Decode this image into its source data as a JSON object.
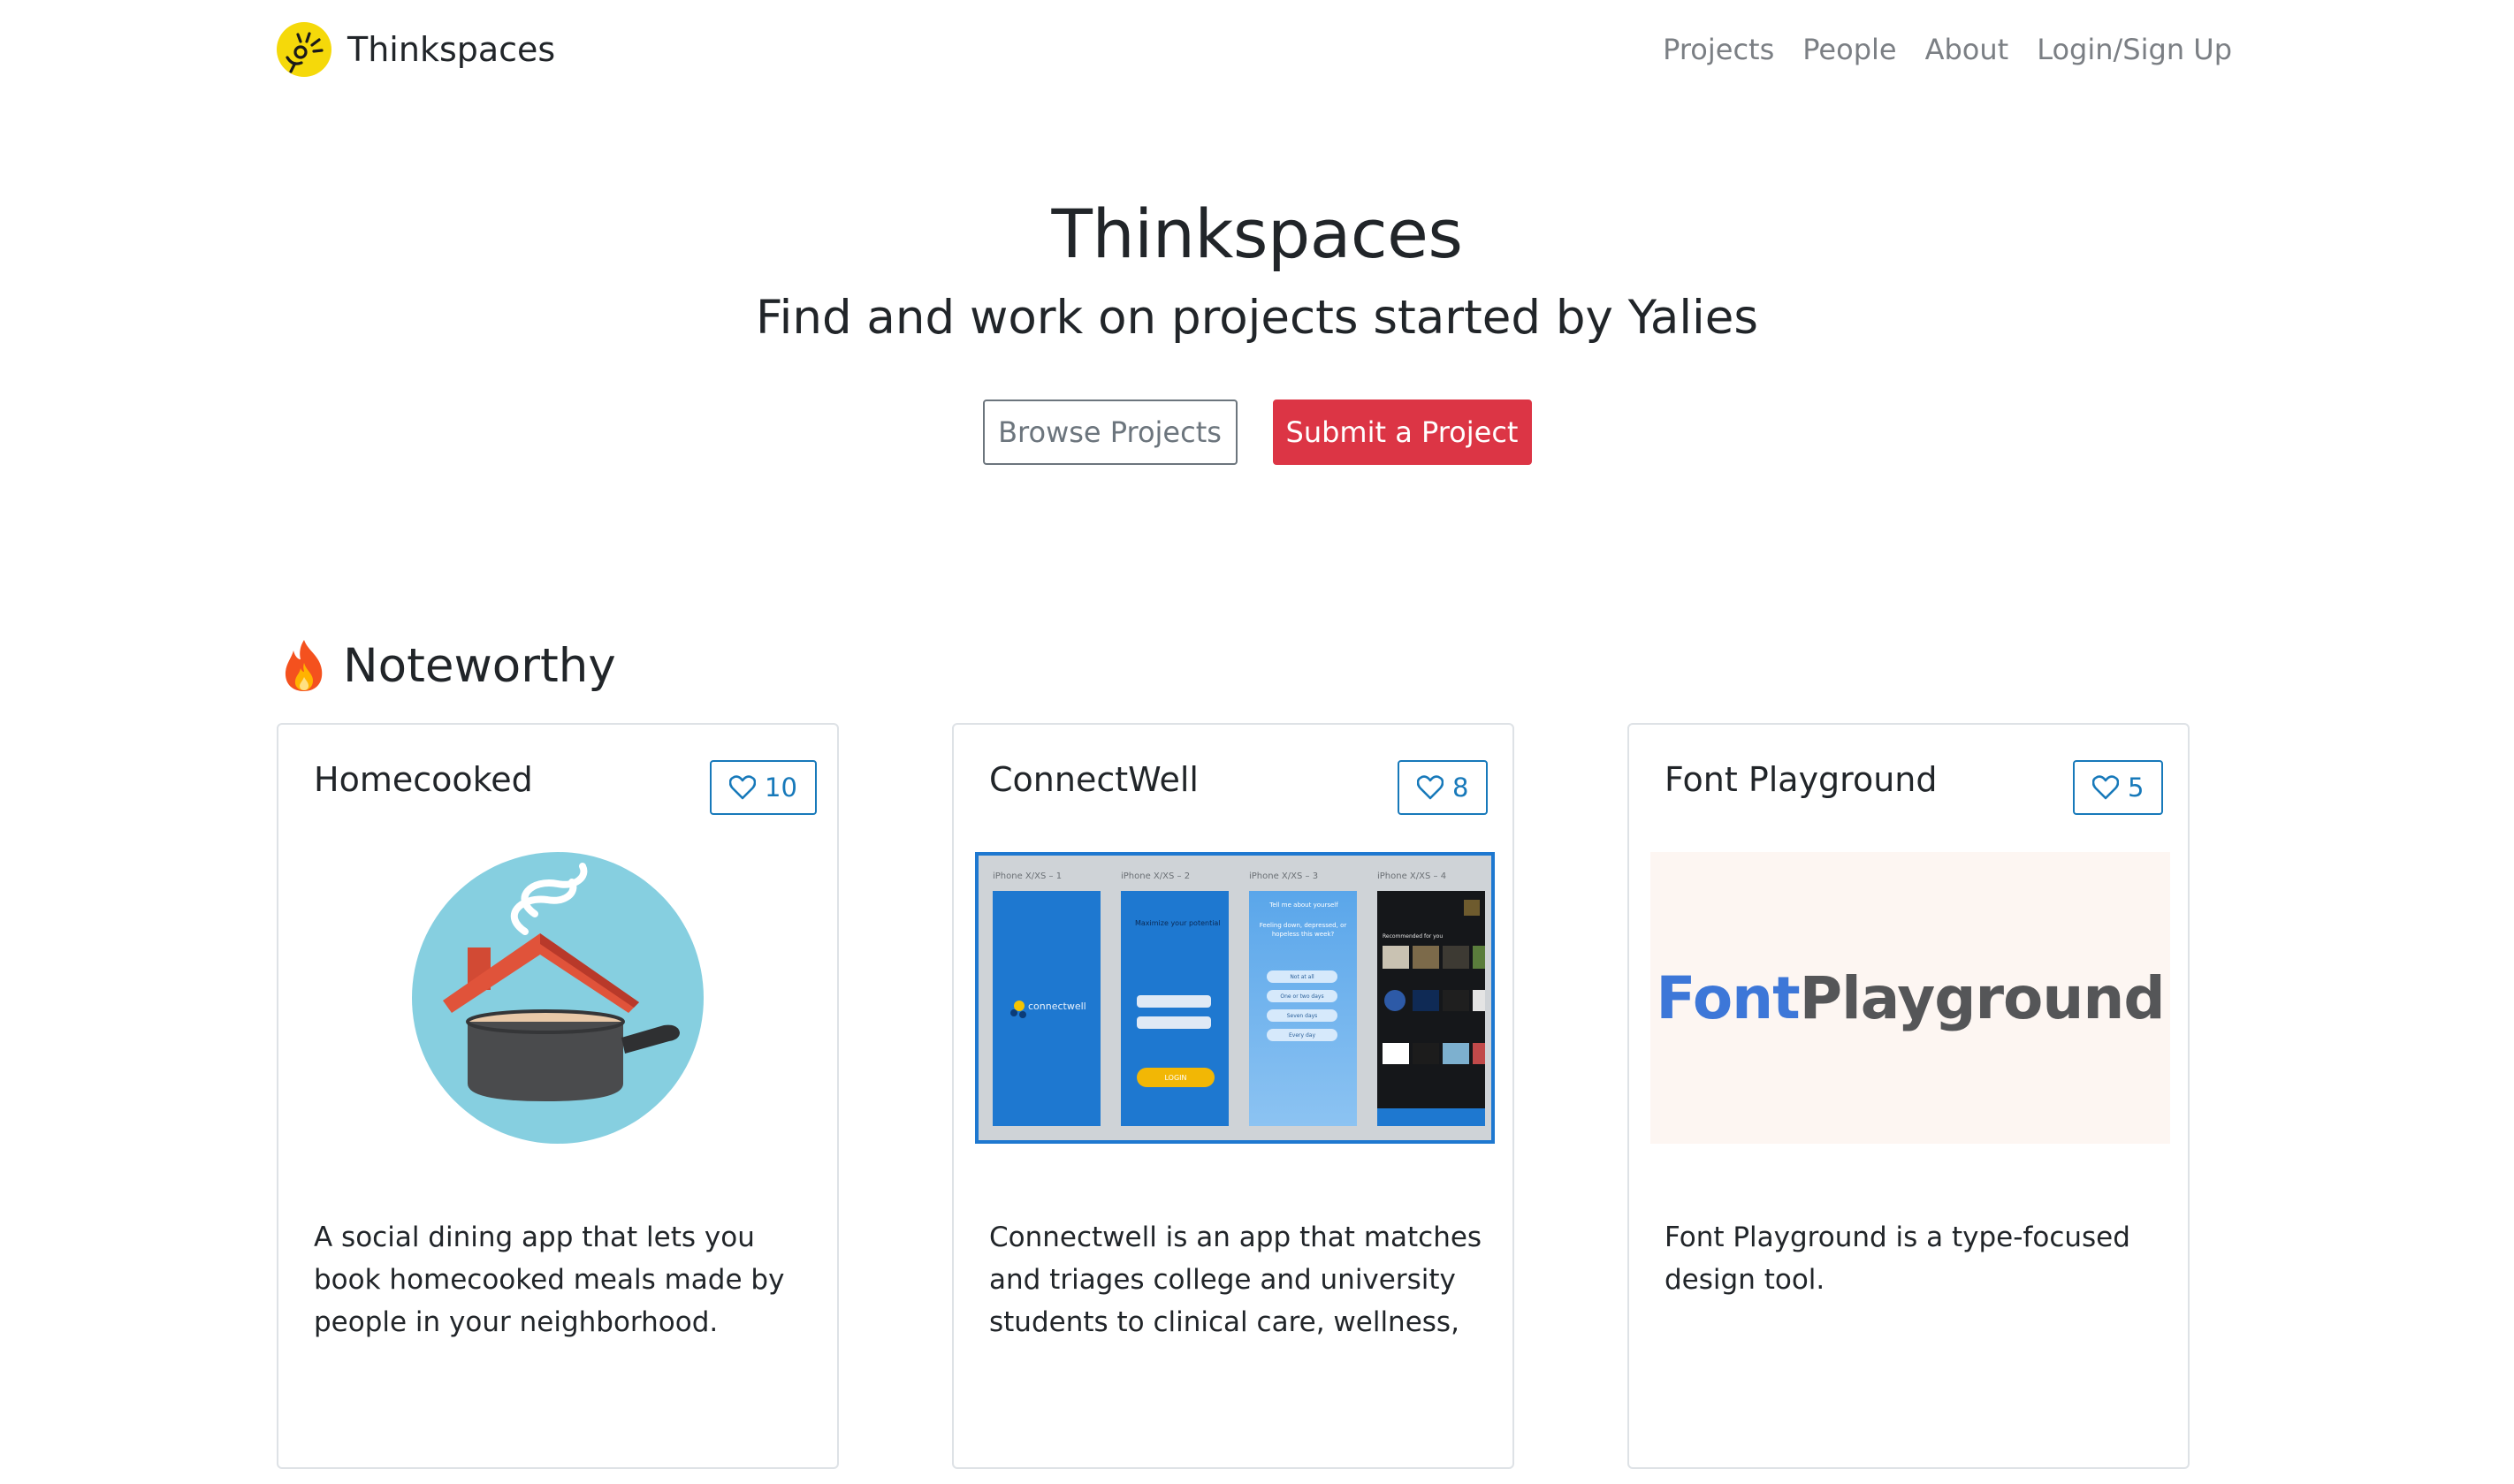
{
  "navbar": {
    "brand": "Thinkspaces",
    "links": [
      "Projects",
      "People",
      "About",
      "Login/Sign Up"
    ]
  },
  "hero": {
    "title": "Thinkspaces",
    "subtitle": "Find and work on projects started by Yalies",
    "browse_label": "Browse Projects",
    "submit_label": "Submit a Project"
  },
  "section": {
    "title": "Noteworthy",
    "icon": "fire-icon"
  },
  "cards": [
    {
      "title": "Homecooked",
      "likes": "10",
      "description": "A social dining app that lets you book homecooked meals made by people in your neighborhood."
    },
    {
      "title": "ConnectWell",
      "likes": "8",
      "description": "Connectwell is an app that matches and triages college and university students to clinical care, wellness,",
      "screens": {
        "labels": [
          "iPhone X/XS – 1",
          "iPhone X/XS – 2",
          "iPhone X/XS – 3",
          "iPhone X/XS – 4"
        ],
        "logo_text": "connectwell",
        "login_heading": "Maximize your potential",
        "login_button": "LOGIN",
        "quiz_heading": "Tell me about yourself",
        "quiz_question": "Feeling down, depressed, or hopeless this week?",
        "quiz_options": [
          "Not at all",
          "One or two days",
          "Seven days",
          "Every day"
        ],
        "feed_heading": "Recommended for you"
      }
    },
    {
      "title": "Font Playground",
      "likes": "5",
      "description": "Font Playground is a type-focused design tool.",
      "logo_part1": "Font",
      "logo_part2": "Playground"
    }
  ],
  "colors": {
    "primary_outline": "#1779ba",
    "danger": "#dc3545",
    "secondary": "#6c757d",
    "connectwell_blue": "#1e78d0",
    "fontplayground_blue": "#3d77d8",
    "logo_yellow": "#f5d90a"
  }
}
